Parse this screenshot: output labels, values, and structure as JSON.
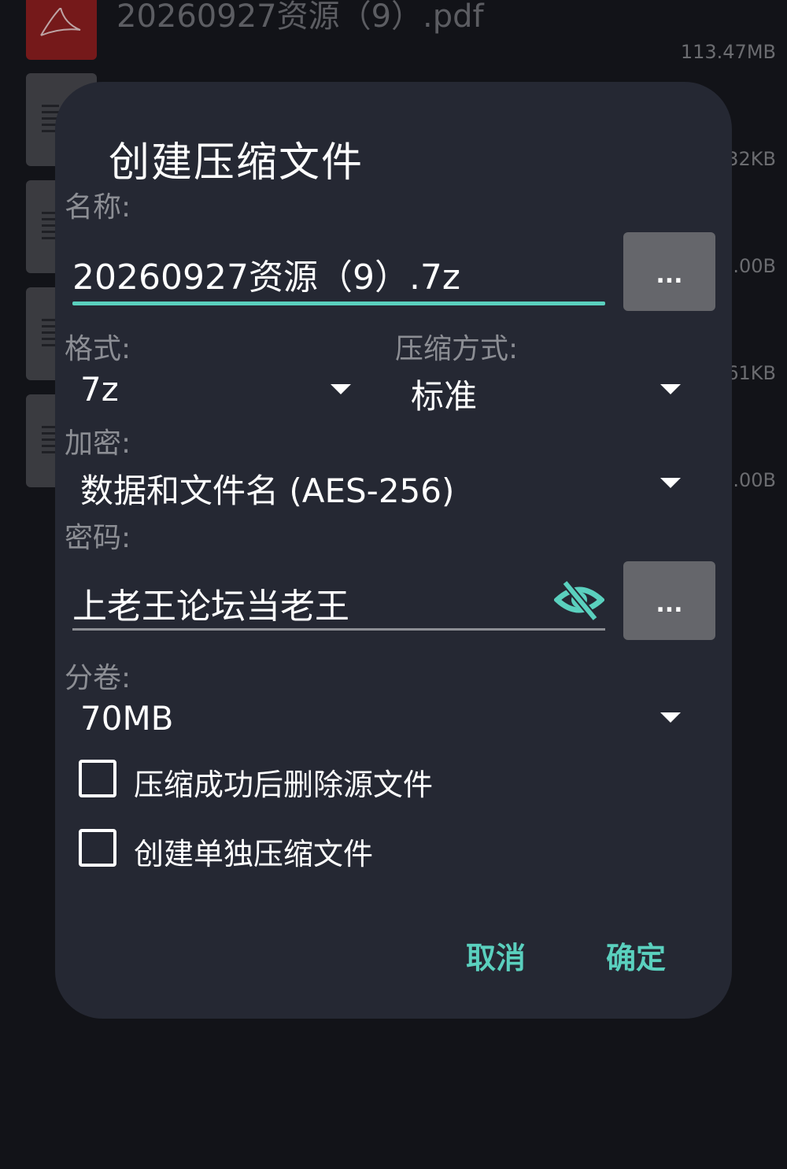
{
  "background_list": {
    "top_file": {
      "name": "20260927资源（9）.pdf",
      "size": "113.47MB"
    },
    "sizes": [
      "32KB",
      ".00B",
      "61KB",
      ".00B"
    ]
  },
  "dialog": {
    "title": "创建压缩文件",
    "name_label": "名称:",
    "name_value": "20260927资源（9）.7z",
    "browse_label": "...",
    "format_label": "格式:",
    "format_value": "7z",
    "method_label": "压缩方式:",
    "method_value": "标准",
    "encrypt_label": "加密:",
    "encrypt_value": "数据和文件名 (AES-256)",
    "password_label": "密码:",
    "password_value": "上老王论坛当老王",
    "password_more_label": "...",
    "split_label": "分卷:",
    "split_value": "70MB",
    "checkbox_delete_label": "压缩成功后删除源文件",
    "checkbox_separate_label": "创建单独压缩文件",
    "cancel_label": "取消",
    "ok_label": "确定"
  },
  "colors": {
    "accent": "#5ad0be",
    "dialog_bg": "#252833",
    "page_bg": "#121318"
  },
  "icons": [
    "pdf-icon",
    "document-icon",
    "eye-off-icon",
    "dropdown-caret-icon"
  ]
}
